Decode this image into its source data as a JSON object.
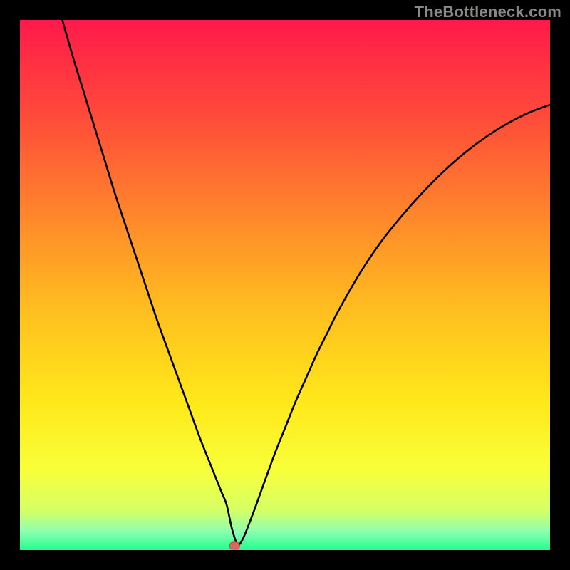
{
  "watermark": "TheBottleneck.com",
  "colors": {
    "frame": "#000000",
    "curve": "#000000",
    "marker_fill": "#d46a5f",
    "marker_stroke": "#b64a3f",
    "gradient_stops": [
      {
        "offset": 0.0,
        "color": "#ff1a4a"
      },
      {
        "offset": 0.18,
        "color": "#ff4a3a"
      },
      {
        "offset": 0.38,
        "color": "#ff8a2a"
      },
      {
        "offset": 0.55,
        "color": "#ffbf1f"
      },
      {
        "offset": 0.72,
        "color": "#ffe81a"
      },
      {
        "offset": 0.85,
        "color": "#f8ff3a"
      },
      {
        "offset": 0.925,
        "color": "#d6ff66"
      },
      {
        "offset": 0.965,
        "color": "#8dffb0"
      },
      {
        "offset": 1.0,
        "color": "#22ff8f"
      }
    ]
  },
  "chart_data": {
    "type": "line",
    "title": "",
    "xlabel": "",
    "ylabel": "",
    "xlim": [
      0,
      100
    ],
    "ylim": [
      0,
      100
    ],
    "grid": false,
    "legend": false,
    "marker": {
      "x": 40.5,
      "y": 0.8
    },
    "series": [
      {
        "name": "curve",
        "x": [
          6,
          8,
          10,
          12,
          14,
          16,
          18,
          20,
          22,
          24,
          26,
          28,
          30,
          32,
          34,
          36,
          38,
          39,
          40,
          41,
          42,
          44,
          46,
          48,
          50,
          52,
          54,
          56,
          58,
          60,
          64,
          68,
          72,
          76,
          80,
          84,
          88,
          92,
          96,
          100
        ],
        "y": [
          108,
          100,
          93,
          86.5,
          80,
          73.5,
          67,
          61,
          55,
          49,
          43,
          37.5,
          32,
          26.5,
          21,
          16,
          11,
          8.5,
          4,
          1.2,
          2,
          7,
          12.5,
          18,
          23,
          28,
          32.5,
          37,
          41,
          45,
          52,
          58,
          63,
          67.5,
          71.5,
          75,
          78,
          80.5,
          82.5,
          84
        ]
      }
    ]
  }
}
